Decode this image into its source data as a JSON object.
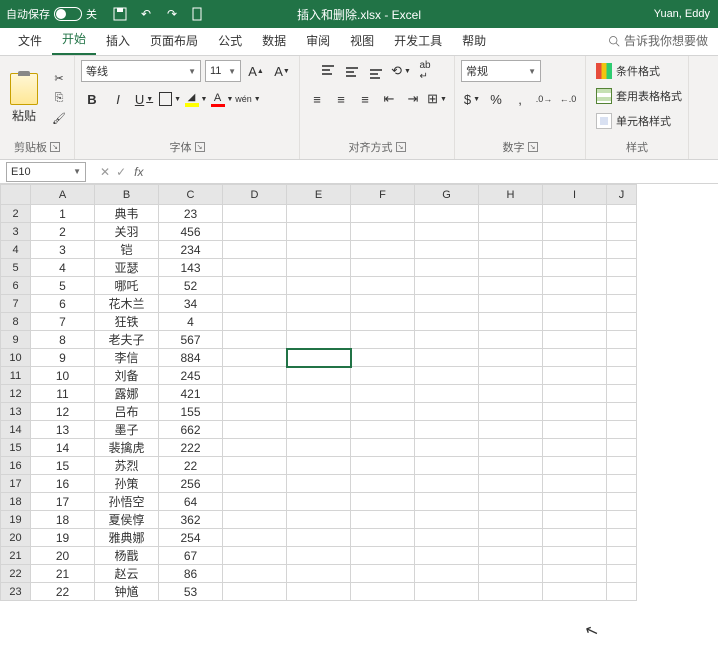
{
  "title_bar": {
    "autosave": "自动保存",
    "autosave_state": "关",
    "document": "插入和删除.xlsx  -  Excel",
    "user": "Yuan, Eddy"
  },
  "tabs": {
    "file": "文件",
    "home": "开始",
    "insert": "插入",
    "layout": "页面布局",
    "formulas": "公式",
    "data": "数据",
    "review": "审阅",
    "view": "视图",
    "developer": "开发工具",
    "help": "帮助",
    "tell_me": "告诉我你想要做"
  },
  "ribbon": {
    "clipboard": {
      "paste": "粘贴",
      "label": "剪贴板"
    },
    "font": {
      "name": "等线",
      "size": "11",
      "bold": "B",
      "italic": "I",
      "underline": "U",
      "phonetic": "wén",
      "label": "字体"
    },
    "alignment": {
      "label": "对齐方式"
    },
    "number": {
      "format": "常规",
      "label": "数字"
    },
    "styles": {
      "cond_format": "条件格式",
      "table_format": "套用表格格式",
      "cell_style": "单元格样式",
      "label": "样式"
    }
  },
  "formula_bar": {
    "name_box": "E10",
    "formula": ""
  },
  "grid": {
    "cols": [
      "A",
      "B",
      "C",
      "D",
      "E",
      "F",
      "G",
      "H",
      "I",
      "J"
    ],
    "rows": [
      {
        "r": 2,
        "A": "1",
        "B": "典韦",
        "C": "23"
      },
      {
        "r": 3,
        "A": "2",
        "B": "关羽",
        "C": "456"
      },
      {
        "r": 4,
        "A": "3",
        "B": "铠",
        "C": "234"
      },
      {
        "r": 5,
        "A": "4",
        "B": "亚瑟",
        "C": "143"
      },
      {
        "r": 6,
        "A": "5",
        "B": "哪吒",
        "C": "52"
      },
      {
        "r": 7,
        "A": "6",
        "B": "花木兰",
        "C": "34"
      },
      {
        "r": 8,
        "A": "7",
        "B": "狂铁",
        "C": "4"
      },
      {
        "r": 9,
        "A": "8",
        "B": "老夫子",
        "C": "567"
      },
      {
        "r": 10,
        "A": "9",
        "B": "李信",
        "C": "884"
      },
      {
        "r": 11,
        "A": "10",
        "B": "刘备",
        "C": "245"
      },
      {
        "r": 12,
        "A": "11",
        "B": "露娜",
        "C": "421"
      },
      {
        "r": 13,
        "A": "12",
        "B": "吕布",
        "C": "155"
      },
      {
        "r": 14,
        "A": "13",
        "B": "墨子",
        "C": "662"
      },
      {
        "r": 15,
        "A": "14",
        "B": "裴擒虎",
        "C": "222"
      },
      {
        "r": 16,
        "A": "15",
        "B": "苏烈",
        "C": "22"
      },
      {
        "r": 17,
        "A": "16",
        "B": "孙策",
        "C": "256"
      },
      {
        "r": 18,
        "A": "17",
        "B": "孙悟空",
        "C": "64"
      },
      {
        "r": 19,
        "A": "18",
        "B": "夏侯惇",
        "C": "362"
      },
      {
        "r": 20,
        "A": "19",
        "B": "雅典娜",
        "C": "254"
      },
      {
        "r": 21,
        "A": "20",
        "B": "杨戬",
        "C": "67"
      },
      {
        "r": 22,
        "A": "21",
        "B": "赵云",
        "C": "86"
      },
      {
        "r": 23,
        "A": "22",
        "B": "钟馗",
        "C": "53"
      }
    ],
    "selected": "E10"
  }
}
